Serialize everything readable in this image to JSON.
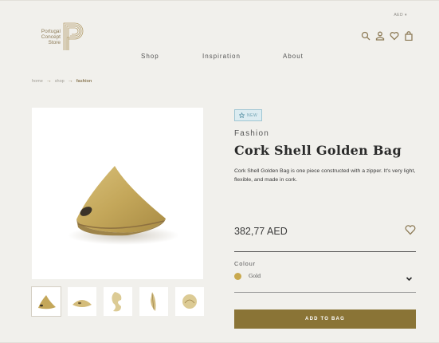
{
  "header": {
    "currency": "AED ▾",
    "logo_text": [
      "Portugal",
      "Concept",
      "Store"
    ],
    "nav": [
      "Shop",
      "Inspiration",
      "About"
    ],
    "icons": [
      "search-icon",
      "user-icon",
      "heart-icon",
      "bag-icon"
    ]
  },
  "breadcrumb": {
    "items": [
      "home",
      "shop",
      "fashion"
    ]
  },
  "product": {
    "badge": "NEW",
    "category": "Fashion",
    "title": "Cork Shell Golden Bag",
    "description": "Cork Shell Golden Bag is one piece constructed with a zipper. It's very light, flexible, and made in cork.",
    "price": "382,77 AED",
    "colour_label": "Colour",
    "colour_value": "Gold",
    "colour_hex": "#c9a94e",
    "add_button": "ADD TO BAG"
  },
  "colors": {
    "accent": "#8a7436",
    "gold_logo": "#8e7c58",
    "background": "#f1f0ec",
    "badge_blue": "#6a9fb0"
  }
}
